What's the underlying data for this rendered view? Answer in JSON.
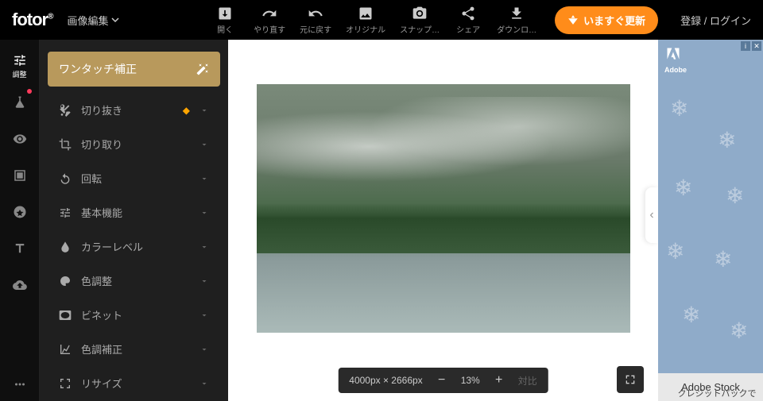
{
  "header": {
    "logo": "fotor",
    "dropdown": "画像編集",
    "tools": {
      "open": "開く",
      "redo": "やり直す",
      "undo": "元に戻す",
      "original": "オリジナル",
      "snap": "スナップ…",
      "share": "シェア",
      "download": "ダウンロ…"
    },
    "upgrade": "いますぐ更新",
    "login": "登録 / ログイン"
  },
  "nav": {
    "adjust": "調整"
  },
  "panel": {
    "enhance": "ワンタッチ補正",
    "items": [
      {
        "label": "切り抜き",
        "premium": true
      },
      {
        "label": "切り取り"
      },
      {
        "label": "回転"
      },
      {
        "label": "基本機能"
      },
      {
        "label": "カラーレベル"
      },
      {
        "label": "色調整"
      },
      {
        "label": "ビネット"
      },
      {
        "label": "色調補正"
      },
      {
        "label": "リサイズ"
      }
    ]
  },
  "canvas": {
    "dimensions": "4000px × 2666px",
    "zoom": "13%",
    "compare": "対比"
  },
  "ad": {
    "brand": "Adobe",
    "product": "Adobe Stock",
    "cta": "クレジットパックで"
  }
}
